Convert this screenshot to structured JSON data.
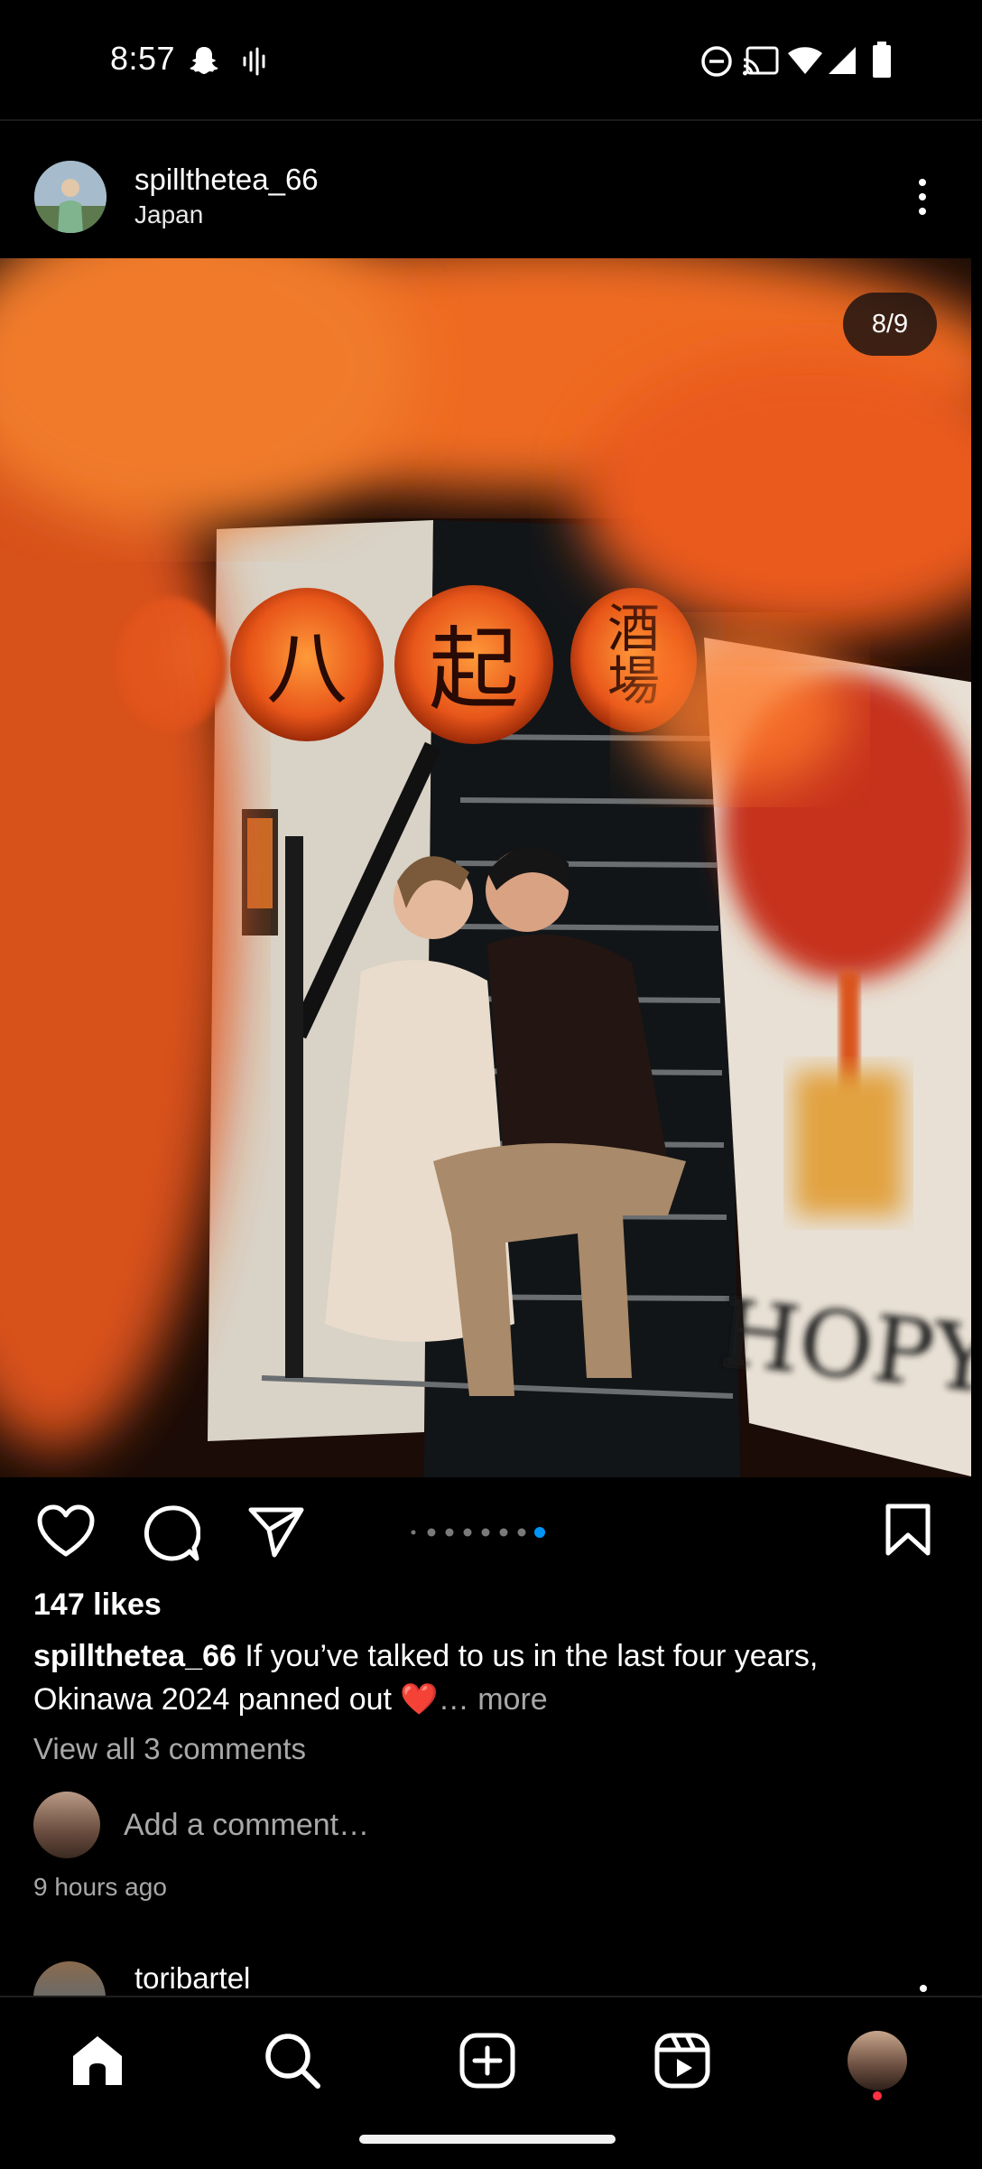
{
  "status_bar": {
    "time": "8:57",
    "icons": [
      "snapchat-icon",
      "voice-icon",
      "dnd-icon",
      "cast-icon",
      "wifi-icon",
      "signal-icon",
      "battery-icon"
    ]
  },
  "post": {
    "username": "spillthetea_66",
    "location": "Japan",
    "image_counter": "8/9",
    "carousel": {
      "total": 9,
      "active_index": 7
    },
    "likes": "147 likes",
    "caption_user": "spillthetea_66",
    "caption_text": " If you’ve talked to us in the last four years, Okinawa 2024 panned out ❤️",
    "caption_more": "… more",
    "view_comments": "View all 3 comments",
    "add_comment_placeholder": "Add a comment…",
    "timestamp": "9 hours ago"
  },
  "next_post": {
    "username": "toribartel"
  },
  "colors": {
    "background": "#000000",
    "secondary_text": "#a8a8a8",
    "active_dot": "#0095f6",
    "notification_dot": "#ff3040"
  },
  "nav": [
    "home-icon",
    "search-icon",
    "create-icon",
    "reels-icon",
    "profile-avatar"
  ]
}
